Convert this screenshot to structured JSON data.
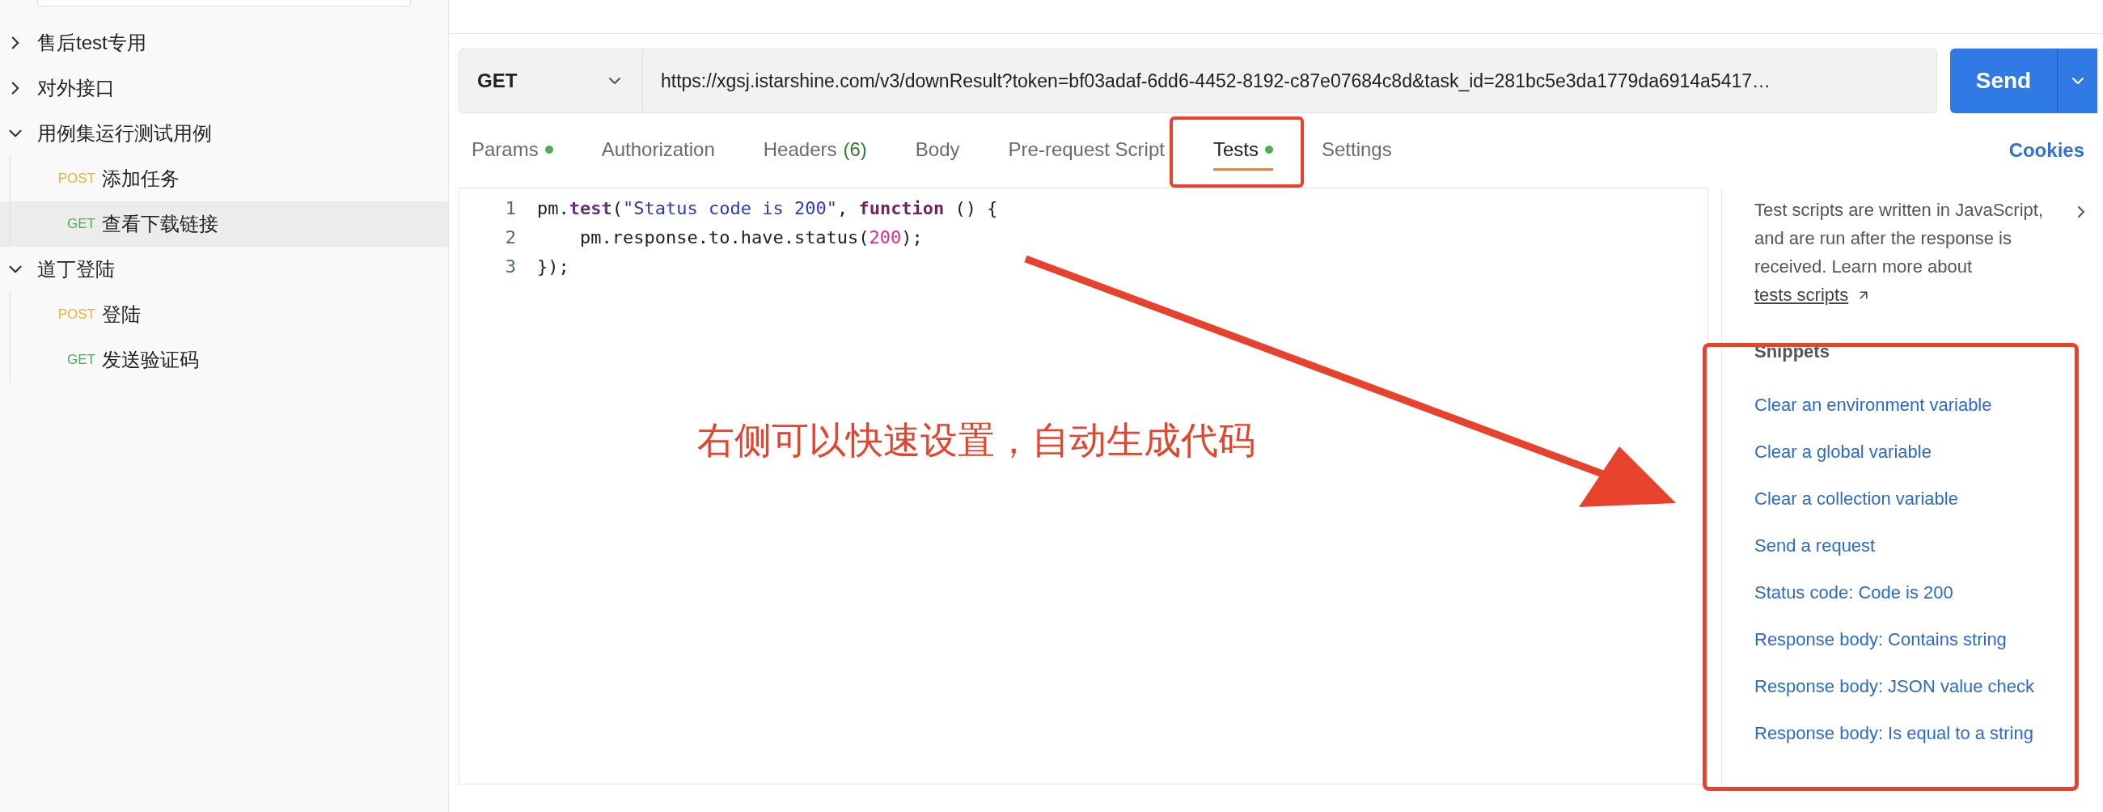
{
  "sidebar": {
    "items": [
      {
        "label": "售后test专用",
        "expanded": false
      },
      {
        "label": "对外接口",
        "expanded": false
      },
      {
        "label": "用例集运行测试用例",
        "expanded": true,
        "children": [
          {
            "method": "POST",
            "kind": "post",
            "label": "添加任务",
            "selected": false
          },
          {
            "method": "GET",
            "kind": "get",
            "label": "查看下载链接",
            "selected": true
          }
        ]
      },
      {
        "label": "道丁登陆",
        "expanded": true,
        "children": [
          {
            "method": "POST",
            "kind": "post",
            "label": "登陆",
            "selected": false
          },
          {
            "method": "GET",
            "kind": "get",
            "label": "发送验证码",
            "selected": false
          }
        ]
      }
    ]
  },
  "request": {
    "method": "GET",
    "url": "https://xgsj.istarshine.com/v3/downResult?token=bf03adaf-6dd6-4452-8192-c87e07684c8d&task_id=281bc5e3da1779da6914a5417…",
    "send": "Send"
  },
  "tabs": [
    {
      "label": "Params",
      "dot": true,
      "selected": false
    },
    {
      "label": "Authorization",
      "dot": false,
      "selected": false
    },
    {
      "label": "Headers",
      "count": "(6)",
      "dot": false,
      "selected": false
    },
    {
      "label": "Body",
      "dot": false,
      "selected": false
    },
    {
      "label": "Pre-request Script",
      "dot": false,
      "selected": false
    },
    {
      "label": "Tests",
      "dot": true,
      "selected": true
    },
    {
      "label": "Settings",
      "dot": false,
      "selected": false
    }
  ],
  "cookies": "Cookies",
  "editor": {
    "lines": [
      {
        "number": "1",
        "tokens": [
          {
            "text": "pm.",
            "kind": "plain"
          },
          {
            "text": "test",
            "kind": "fn"
          },
          {
            "text": "(",
            "kind": "plain"
          },
          {
            "text": "\"Status code is 200\"",
            "kind": "string"
          },
          {
            "text": ", ",
            "kind": "plain"
          },
          {
            "text": "function",
            "kind": "keyword"
          },
          {
            "text": " () {",
            "kind": "plain"
          }
        ]
      },
      {
        "number": "2",
        "tokens": [
          {
            "text": "    pm.response.to.have.status(",
            "kind": "plain"
          },
          {
            "text": "200",
            "kind": "number"
          },
          {
            "text": ");",
            "kind": "plain"
          }
        ]
      },
      {
        "number": "3",
        "tokens": [
          {
            "text": "});",
            "kind": "plain"
          }
        ]
      }
    ]
  },
  "side_panel": {
    "description": "Test scripts are written in JavaScript, and are run after the response is received. Learn more about",
    "link": "tests scripts",
    "snippets_title": "Snippets",
    "snippets": [
      "Clear an environment variable",
      "Clear a global variable",
      "Clear a collection variable",
      "Send a request",
      "Status code: Code is 200",
      "Response body: Contains string",
      "Response body: JSON value check",
      "Response body: Is equal to a string"
    ]
  },
  "annotation": {
    "text": "右侧可以快速设置，自动生成代码"
  }
}
